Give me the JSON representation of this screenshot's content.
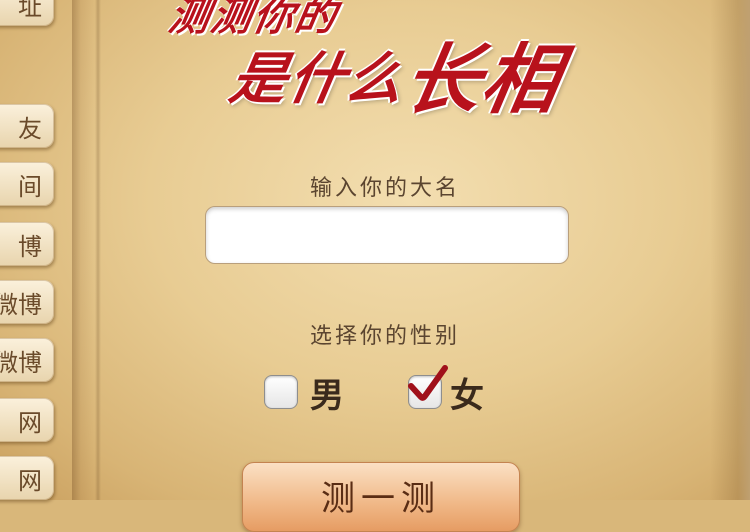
{
  "title": {
    "line1": "测测你的",
    "line2_prefix": "是什么",
    "line2_big": "长相"
  },
  "sidebar": {
    "items": [
      {
        "label": "址"
      },
      {
        "label": "友"
      },
      {
        "label": "间"
      },
      {
        "label": "博"
      },
      {
        "label": "微博"
      },
      {
        "label": "微博"
      },
      {
        "label": "网"
      },
      {
        "label": "网"
      }
    ]
  },
  "form": {
    "name_label": "输入你的大名",
    "name_value": "",
    "name_placeholder": "",
    "gender_label": "选择你的性别",
    "gender_options": [
      {
        "label": "男",
        "checked": false
      },
      {
        "label": "女",
        "checked": true
      }
    ],
    "submit_label": "测一测"
  },
  "colors": {
    "title_red": "#b8121c",
    "check_red": "#a0101a",
    "paper": "#e8cc93"
  }
}
